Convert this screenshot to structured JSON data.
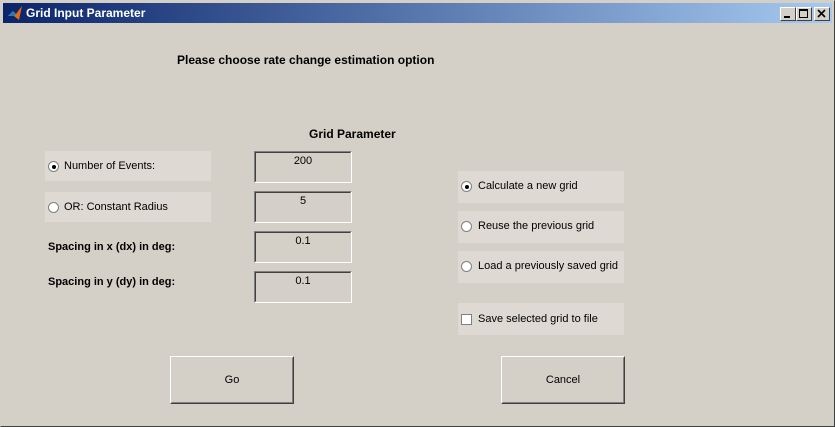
{
  "window": {
    "title": "Grid Input Parameter",
    "app_icon": "matlab-icon",
    "controls": [
      "minimize-icon",
      "maximize-icon",
      "close-icon"
    ]
  },
  "main": {
    "instruction": "Please choose rate change estimation option",
    "grid_parameter_title": "Grid Parameter"
  },
  "params": {
    "number_of_events": {
      "label": "Number of Events:",
      "value": "200",
      "selected": true
    },
    "constant_radius": {
      "label": "OR: Constant Radius",
      "value": "5",
      "selected": false
    },
    "spacing_x": {
      "label": "Spacing in x (dx) in deg:",
      "value": "0.1"
    },
    "spacing_y": {
      "label": "Spacing in y (dy) in deg:",
      "value": "0.1"
    }
  },
  "grid_options": {
    "calculate_new": {
      "label": "Calculate a new grid",
      "selected": true
    },
    "reuse_previous": {
      "label": "Reuse the previous grid",
      "selected": false
    },
    "load_saved": {
      "label": "Load a previously saved grid",
      "selected": false
    },
    "save_to_file": {
      "label": "Save selected grid to file",
      "checked": false
    }
  },
  "buttons": {
    "go": "Go",
    "cancel": "Cancel"
  }
}
